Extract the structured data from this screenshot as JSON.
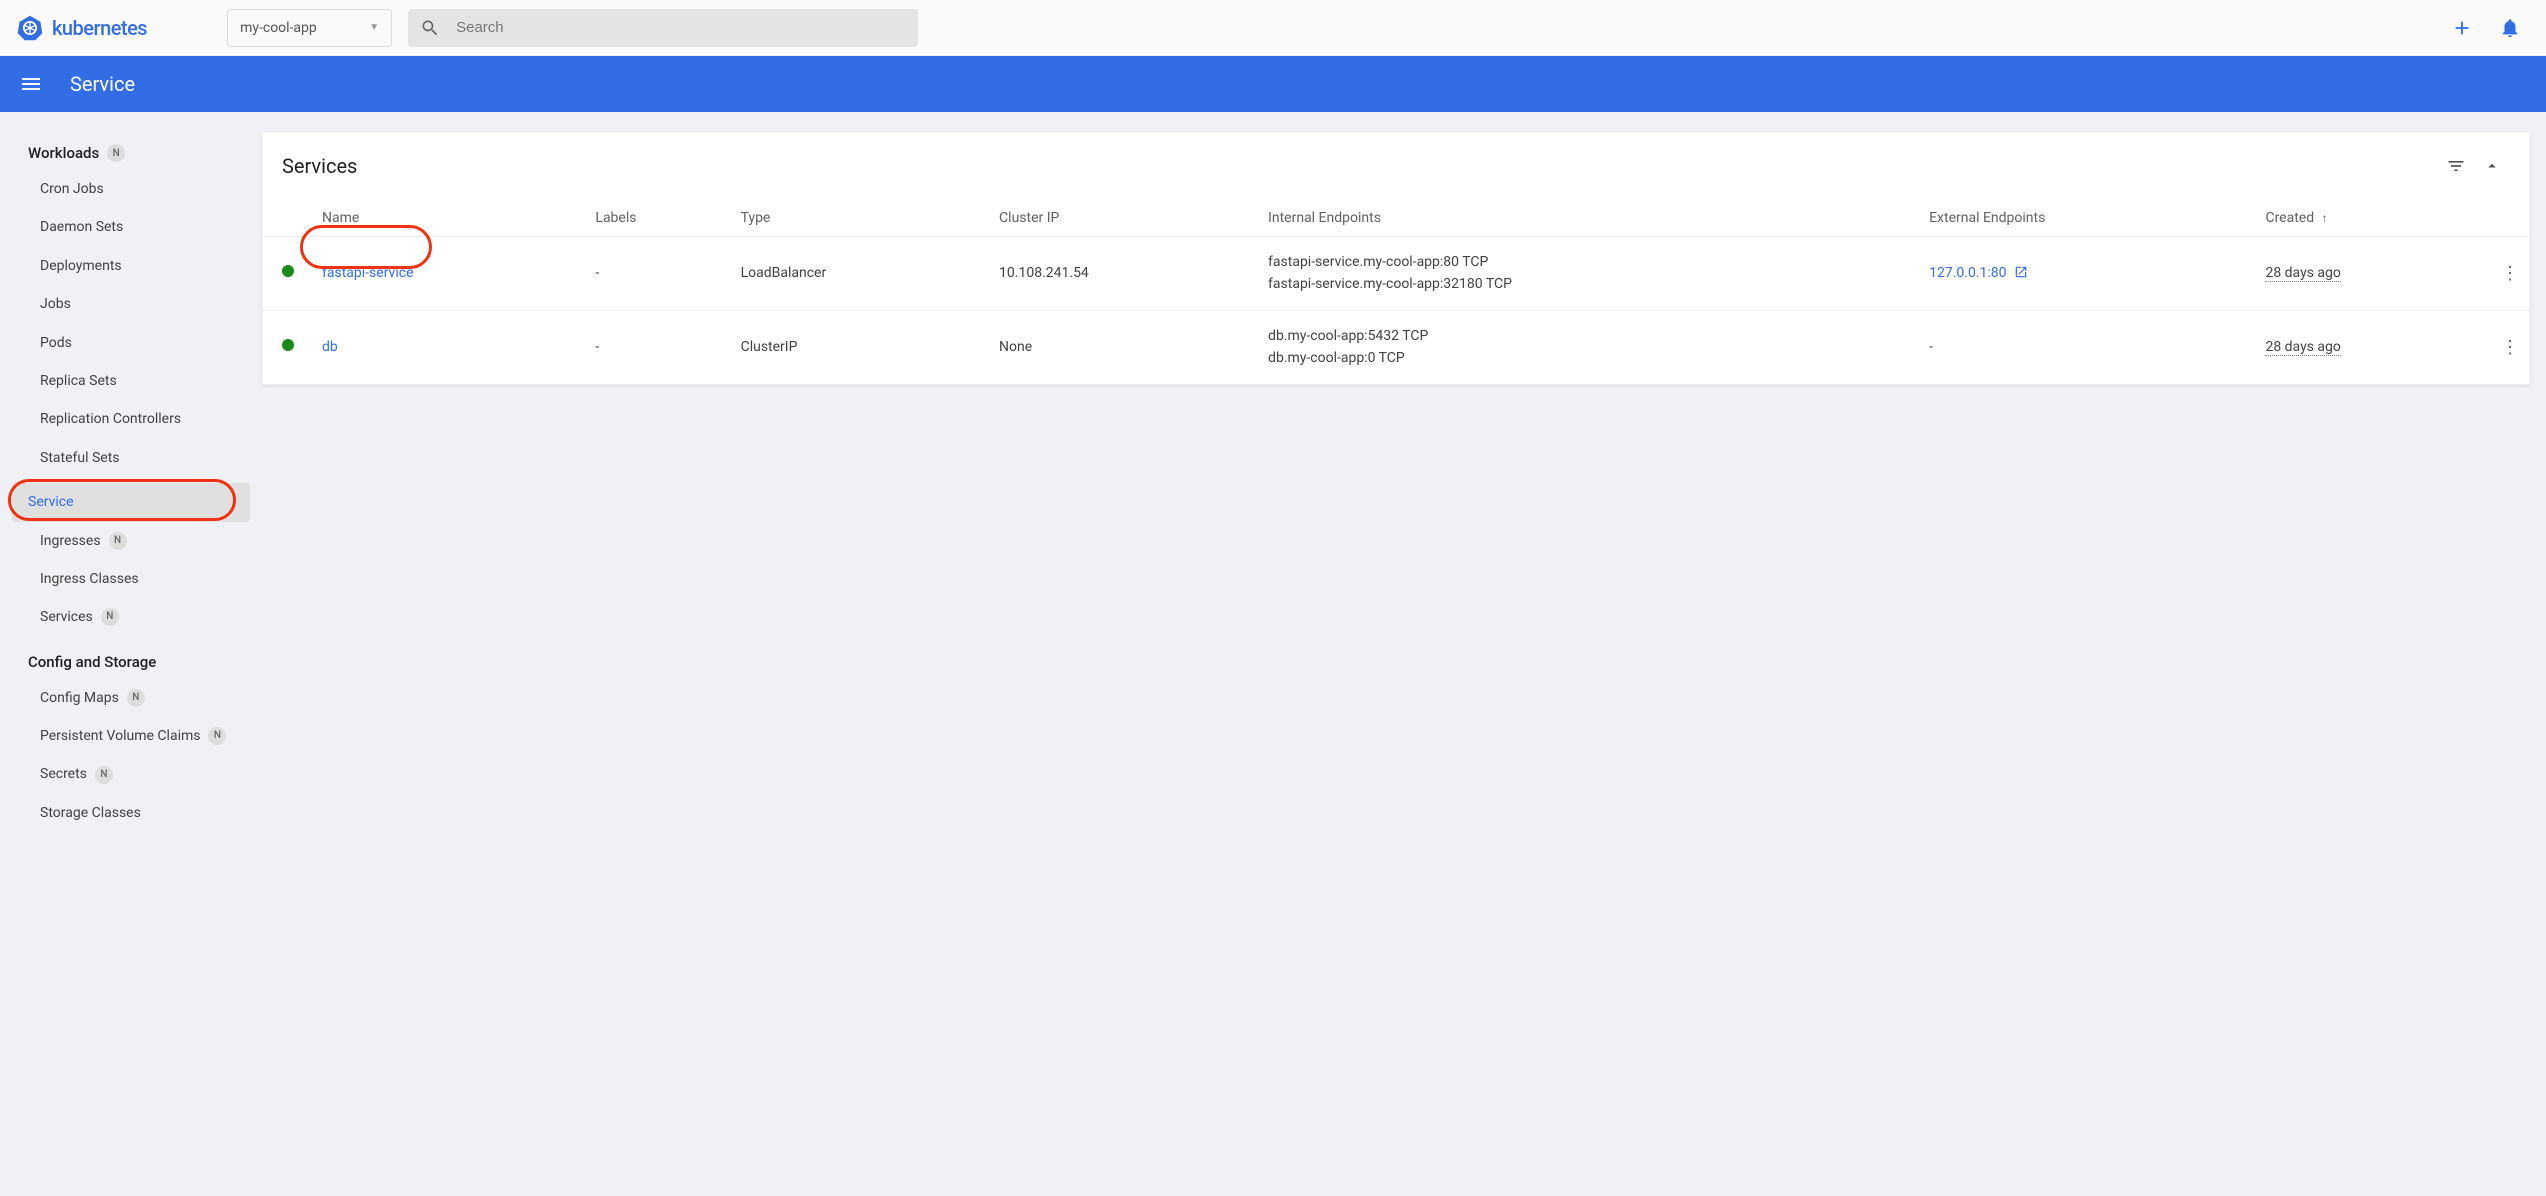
{
  "header": {
    "brand": "kubernetes",
    "namespace": "my-cool-app",
    "search_placeholder": "Search"
  },
  "actionbar": {
    "title": "Service"
  },
  "sidebar": {
    "sections": [
      {
        "header": "Workloads",
        "header_badge": "N",
        "items": [
          {
            "label": "Cron Jobs",
            "badge": null,
            "selected": false
          },
          {
            "label": "Daemon Sets",
            "badge": null,
            "selected": false
          },
          {
            "label": "Deployments",
            "badge": null,
            "selected": false
          },
          {
            "label": "Jobs",
            "badge": null,
            "selected": false
          },
          {
            "label": "Pods",
            "badge": null,
            "selected": false
          },
          {
            "label": "Replica Sets",
            "badge": null,
            "selected": false
          },
          {
            "label": "Replication Controllers",
            "badge": null,
            "selected": false
          },
          {
            "label": "Stateful Sets",
            "badge": null,
            "selected": false
          }
        ]
      },
      {
        "header": "Service",
        "header_selected": true,
        "header_highlighted": true,
        "items": [
          {
            "label": "Ingresses",
            "badge": "N",
            "selected": false
          },
          {
            "label": "Ingress Classes",
            "badge": null,
            "selected": false
          },
          {
            "label": "Services",
            "badge": "N",
            "selected": false
          }
        ]
      },
      {
        "header": "Config and Storage",
        "items": [
          {
            "label": "Config Maps",
            "badge": "N",
            "selected": false
          },
          {
            "label": "Persistent Volume Claims",
            "badge": "N",
            "selected": false
          },
          {
            "label": "Secrets",
            "badge": "N",
            "selected": false
          },
          {
            "label": "Storage Classes",
            "badge": null,
            "selected": false
          }
        ]
      }
    ]
  },
  "main": {
    "card_title": "Services",
    "columns": {
      "name": "Name",
      "labels": "Labels",
      "type": "Type",
      "cluster_ip": "Cluster IP",
      "internal_ep": "Internal Endpoints",
      "external_ep": "External Endpoints",
      "created": "Created"
    },
    "rows": [
      {
        "status": "running",
        "name": "fastapi-service",
        "name_highlighted": true,
        "labels": "-",
        "type": "LoadBalancer",
        "cluster_ip": "10.108.241.54",
        "internal_ep": [
          "fastapi-service.my-cool-app:80 TCP",
          "fastapi-service.my-cool-app:32180 TCP"
        ],
        "external_ep": "127.0.0.1:80",
        "external_ep_link": true,
        "created": "28 days ago"
      },
      {
        "status": "running",
        "name": "db",
        "labels": "-",
        "type": "ClusterIP",
        "cluster_ip": "None",
        "internal_ep": [
          "db.my-cool-app:5432 TCP",
          "db.my-cool-app:0 TCP"
        ],
        "external_ep": "-",
        "external_ep_link": false,
        "created": "28 days ago"
      }
    ]
  }
}
